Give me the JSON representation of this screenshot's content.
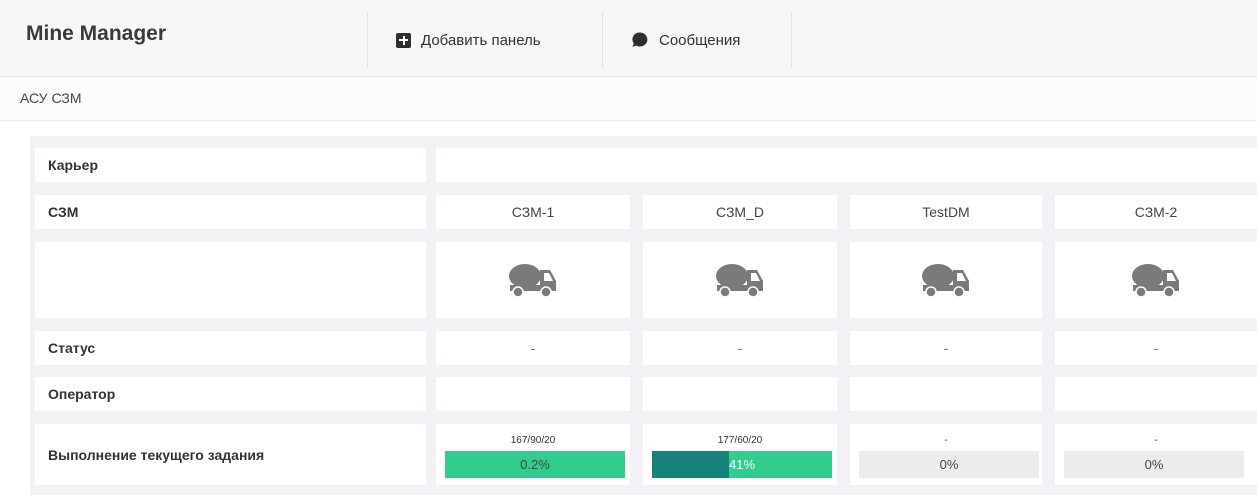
{
  "app": {
    "title": "Mine Manager"
  },
  "nav": {
    "add_panel": {
      "label": "Добавить панель",
      "icon": "add-square-icon"
    },
    "messages": {
      "label": "Сообщения",
      "icon": "chat-bubble-icon"
    }
  },
  "breadcrumb": {
    "text": "АСУ СЗМ"
  },
  "table": {
    "row_labels": {
      "quarry": "Карьер",
      "machine": "СЗМ",
      "status": "Статус",
      "operator": "Оператор",
      "progress": "Выполнение текущего задания"
    },
    "machines": [
      {
        "name": "СЗМ-1",
        "icon": "concrete-mixer-truck-icon",
        "status": "-",
        "operator": "",
        "task": "167/90/20",
        "progress_label": "0.2%",
        "progress_value": 100,
        "bar_color": "#33cc8f"
      },
      {
        "name": "СЗМ_D",
        "icon": "concrete-mixer-truck-icon",
        "status": "-",
        "operator": "",
        "task": "177/60/20",
        "progress_label": "41%",
        "progress_value": 41,
        "bar_color": "#33cc8f",
        "bar_fill_color": "#15837a"
      },
      {
        "name": "TestDM",
        "icon": "concrete-mixer-truck-icon",
        "status": "-",
        "operator": "",
        "task": "-",
        "progress_label": "0%",
        "progress_value": 0,
        "bar_color": "#ececec"
      },
      {
        "name": "СЗМ-2",
        "icon": "concrete-mixer-truck-icon",
        "status": "-",
        "operator": "",
        "task": "-",
        "progress_label": "0%",
        "progress_value": 0,
        "bar_color": "#ececec"
      }
    ]
  },
  "colors": {
    "accent_green": "#33cc8f",
    "dark_teal": "#15837a",
    "truck_gray": "#7a7a7a"
  }
}
